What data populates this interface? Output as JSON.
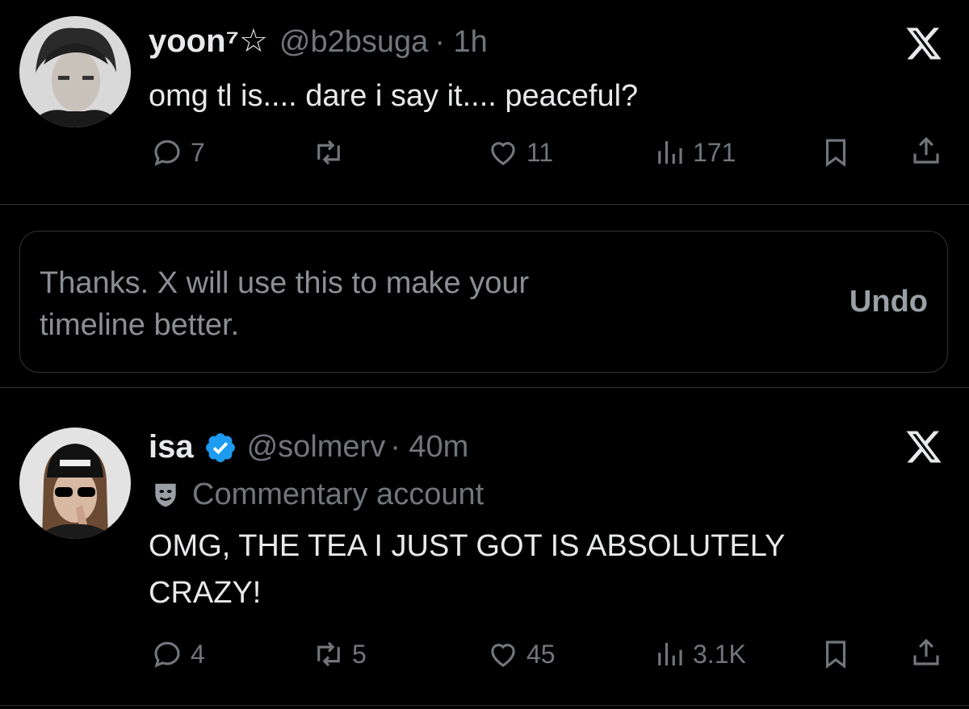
{
  "tweets": [
    {
      "display_name": "yoon⁷☆",
      "handle": "@b2bsuga",
      "time": "· 1h",
      "text": "omg tl is.... dare i say it.... peaceful?",
      "replies": "7",
      "reposts": "",
      "likes": "11",
      "views": "171"
    },
    {
      "display_name": "isa",
      "handle": "@solmerv",
      "time": "· 40m",
      "label": "Commentary account",
      "text_line1": "OMG, THE TEA I JUST GOT IS ABSOLUTELY",
      "text_line2": "CRAZY!",
      "replies": "4",
      "reposts": "5",
      "likes": "45",
      "views": "3.1K"
    }
  ],
  "feedback": {
    "line1": "Thanks. X will use this to make your",
    "line2": "timeline better.",
    "undo_label": "Undo"
  },
  "colors": {
    "background": "#000000",
    "text": "#e7e9ea",
    "muted": "#71767b",
    "verified": "#1d9bf0",
    "divider": "#2f3336"
  }
}
